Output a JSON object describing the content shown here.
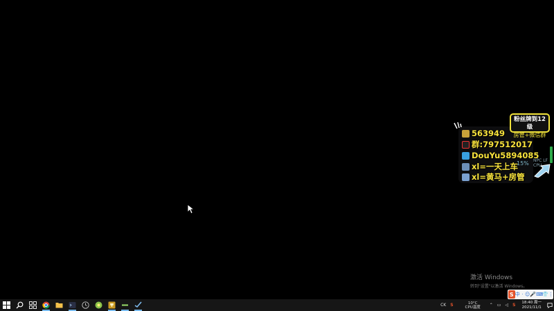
{
  "overlay": {
    "badge_line1": "粉丝牌到12级",
    "badge_line2": "房管+微信群",
    "lines": [
      {
        "icon": "qq-penguin-icon",
        "text": "563949"
      },
      {
        "icon": "group-penguin-icon",
        "text": "群:797512017"
      },
      {
        "icon": "tv-icon",
        "text": "DouYu5894085"
      },
      {
        "icon": "level-icon",
        "text": "xl=一天上车"
      },
      {
        "icon": "level-icon",
        "text": "xl=黄马+房管"
      }
    ],
    "cpu_percent": "15%",
    "cpu_small_line1": "NPC LF",
    "cpu_small_line2": "CPU"
  },
  "watermark": {
    "title": "激活 Windows",
    "subtitle": "转到\"设置\"以激活 Windows。"
  },
  "ime": {
    "logo": "S",
    "items": [
      "中",
      "·",
      "☺",
      "🎤",
      "⌨",
      "👕",
      "⋮"
    ]
  },
  "taskbar": {
    "apps": [
      {
        "name": "start-button",
        "icon": "windows-logo-icon"
      },
      {
        "name": "search-button",
        "icon": "search-icon"
      },
      {
        "name": "task-view-button",
        "icon": "task-view-icon"
      },
      {
        "name": "taskbar-chrome",
        "icon": "chrome-icon"
      },
      {
        "name": "taskbar-file-explorer",
        "icon": "folder-icon"
      },
      {
        "name": "taskbar-terminal",
        "icon": "terminal-icon"
      },
      {
        "name": "taskbar-clock-app",
        "icon": "clock-icon"
      },
      {
        "name": "taskbar-green-app",
        "icon": "green-circle-icon"
      },
      {
        "name": "taskbar-trophy-app",
        "icon": "trophy-icon"
      },
      {
        "name": "taskbar-dash-app",
        "icon": "dash-icon"
      },
      {
        "name": "taskbar-steam",
        "icon": "steam-icon"
      }
    ]
  },
  "tray": {
    "left_label": "CK",
    "weather_temp": "10°C",
    "weather_label": "CPU温度",
    "time": "18:40 周一",
    "date": "2021/11/1"
  },
  "colors": {
    "overlay_text": "#f7e23c",
    "badge_border": "#f2e33a",
    "taskbar_bg": "#161616",
    "running_indicator": "#76b9ed"
  }
}
